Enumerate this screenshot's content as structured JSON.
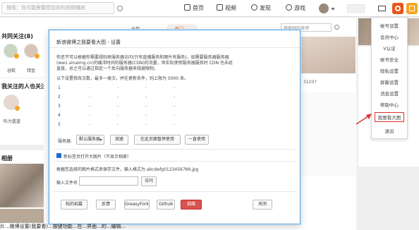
{
  "search": {
    "placeholder": "搜索：你可能需要想找你的视频播放"
  },
  "nav": {
    "home": "首页",
    "video": "视频",
    "discover": "发现",
    "game": "游戏"
  },
  "sidebar": {
    "section1_title": "共同关注(8)",
    "user1": "谷街",
    "user2": "拜金",
    "section2_title": "我关注的人也关注她",
    "user3": "叭力蓝蓝",
    "section3_title": "相册"
  },
  "feed": {
    "tab_label": "全部",
    "pill_label": "热门",
    "search_placeholder": "搜索她的微博",
    "stat": "32207"
  },
  "menu": {
    "items": [
      "帐号设置",
      "会员中心",
      "V认证",
      "帐号安全",
      "隐私设置",
      "屏蔽设置",
      "消息设置",
      "帮助中心",
      "我要看大图",
      "退出"
    ],
    "highlighted_index": 8
  },
  "dialog": {
    "title": "新浪微博之我要看大图 - 设置",
    "intro": [
      "你还不可以根据你需要规则来服务器访问(只有直播服务和图片有服务)，如需要服务器服务器",
      "(ww1.sinaimg.cn)的缓冲时间的服务器(CDN)的流量，但实际使用服务器服务时 CDN 也未经",
      "直接，总之可以通过指定一个反向服务器来规避限制。"
    ],
    "hint": "以下设置修改次数，最多一类次，并在更新条件，则上限为 5000 条。",
    "rows": [
      {
        "num": "1",
        "cols": [
          "-",
          "-",
          "-",
          "-"
        ]
      },
      {
        "num": "2",
        "cols": [
          "-",
          "-",
          "-",
          "-"
        ]
      },
      {
        "num": "3",
        "cols": [
          "-",
          "-",
          "-",
          "-"
        ]
      },
      {
        "num": "4",
        "cols": [
          "-",
          "-",
          "-",
          "-"
        ]
      },
      {
        "num": "5",
        "cols": [
          "-",
          "-",
          "-",
          "-"
        ]
      }
    ],
    "server_label": "服务器:",
    "server_select": "默认服务器",
    "test_button": "测速",
    "enable_button": "在此页面暂停使用",
    "apply_button": "一直使用",
    "checkbox_label": "新标签页打开大图片（不显示相册）",
    "filename_desc": "根据您选择的图片格式来保存文件，输入格式为 abcdefg0123456789.jpg",
    "filename_label": "输入文件名",
    "filename_button": "访问",
    "footer_buttons": [
      "帖的招募",
      "反馈",
      "GreasyFork",
      "Github"
    ],
    "footer_red_button": "捐赠",
    "close_button": "关闭"
  },
  "colors": {
    "accent": "#e8541b",
    "highlight_border": "#e03232",
    "dialog_border": "#5aa5e0",
    "red_button": "#d9534f"
  },
  "caption": "片...微博设置(我要看)...按键功能...在...界面...的...编辑..."
}
